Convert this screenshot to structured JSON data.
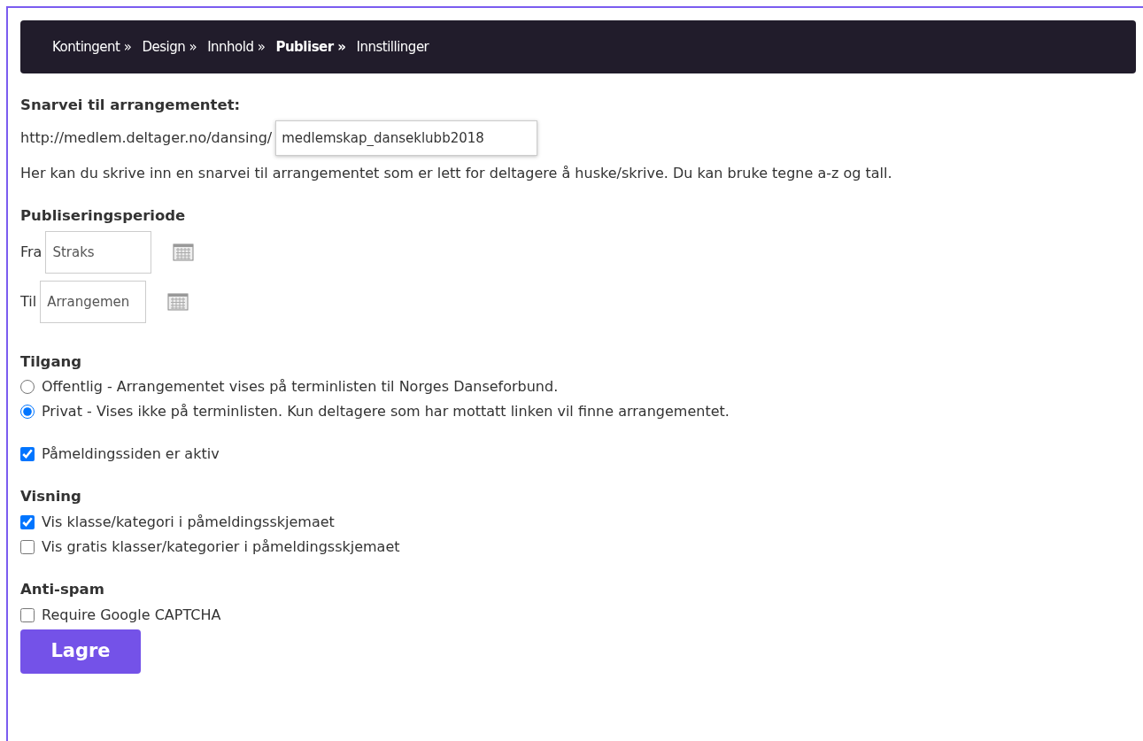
{
  "steps": [
    {
      "label": "Kontingent »",
      "selected": false
    },
    {
      "label": "Design »",
      "selected": false
    },
    {
      "label": "Innhold »",
      "selected": false
    },
    {
      "label": "Publiser »",
      "selected": true
    },
    {
      "label": "Innstillinger",
      "selected": false
    }
  ],
  "shortcut": {
    "heading": "Snarvei til arrangementet:",
    "prefix": "http://medlem.deltager.no/dansing/",
    "value": "medlemskap_danseklubb2018",
    "help": "Her kan du skrive inn en snarvei til arrangementet som er lett for deltagere å huske/skrive. Du kan bruke tegne a-z og tall."
  },
  "period": {
    "heading": "Publiseringsperiode",
    "fields": [
      {
        "label": "Fra",
        "value": "Straks"
      },
      {
        "label": "Til",
        "value": "Arrangemen"
      }
    ]
  },
  "access": {
    "heading": "Tilgang",
    "options": [
      {
        "label": "Offentlig - Arrangementet vises på terminlisten til Norges Danseforbund.",
        "selected": false
      },
      {
        "label": "Privat - Vises ikke på terminlisten. Kun deltagere som har mottatt linken vil finne arrangementet.",
        "selected": true
      }
    ]
  },
  "active": {
    "label": "Påmeldingssiden er aktiv",
    "checked": true
  },
  "display": {
    "heading": "Visning",
    "options": [
      {
        "label": "Vis klasse/kategori i påmeldingsskjemaet",
        "checked": true
      },
      {
        "label": "Vis gratis klasser/kategorier i påmeldingsskjemaet",
        "checked": false
      }
    ]
  },
  "antispam": {
    "heading": "Anti-spam",
    "options": [
      {
        "label": "Require Google CAPTCHA",
        "checked": false
      }
    ]
  },
  "save_button": "Lagre"
}
